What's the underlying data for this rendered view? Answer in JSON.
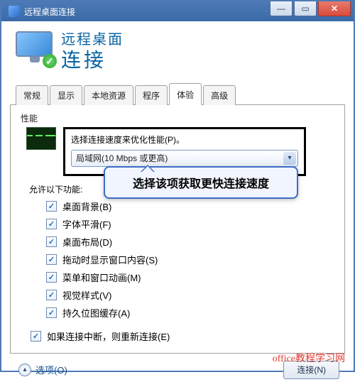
{
  "window": {
    "title": "远程桌面连接"
  },
  "header": {
    "line1": "远程桌面",
    "line2": "连接"
  },
  "tabs": [
    "常规",
    "显示",
    "本地资源",
    "程序",
    "体验",
    "高级"
  ],
  "active_tab_index": 4,
  "panel": {
    "group_label": "性能",
    "speed_label": "选择连接速度来优化性能(P)。",
    "speed_value": "局域网(10 Mbps 或更高)",
    "allow_label": "允许以下功能:",
    "options": [
      {
        "label": "桌面背景(B)",
        "checked": true
      },
      {
        "label": "字体平滑(F)",
        "checked": true
      },
      {
        "label": "桌面布局(D)",
        "checked": true
      },
      {
        "label": "拖动时显示窗口内容(S)",
        "checked": true
      },
      {
        "label": "菜单和窗口动画(M)",
        "checked": true
      },
      {
        "label": "视觉样式(V)",
        "checked": true
      },
      {
        "label": "持久位图缓存(A)",
        "checked": true
      }
    ],
    "reconnect": {
      "label": "如果连接中断，则重新连接(E)",
      "checked": true
    }
  },
  "footer": {
    "options_label": "选项(O)",
    "connect_label": "连接(N)"
  },
  "callout": "选择该项获取更快连接速度",
  "watermark": "office教程学习网",
  "colors": {
    "accent": "#4d7ab5",
    "link": "#1a4e8a",
    "close": "#d94b3b"
  }
}
